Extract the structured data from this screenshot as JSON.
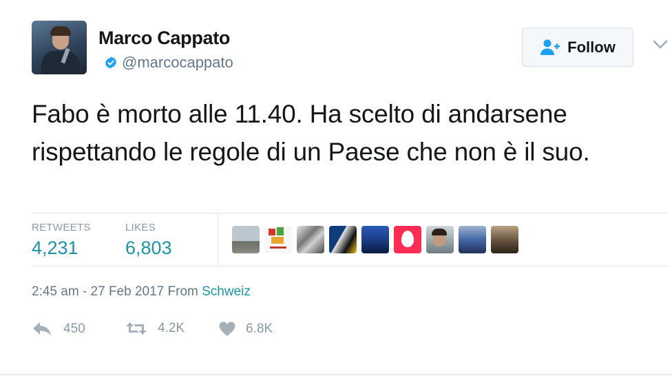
{
  "author": {
    "name": "Marco Cappato",
    "handle": "@marcocappato",
    "verified": true
  },
  "follow_button": {
    "label": "Follow",
    "icon": "follow-user-icon"
  },
  "tweet": {
    "text": "Fabo è morto alle 11.40. Ha scelto di andarsene rispettando le regole di un Paese che non è il suo."
  },
  "stats": {
    "retweets": {
      "label": "RETWEETS",
      "value": "4,231"
    },
    "likes": {
      "label": "LIKES",
      "value": "6,803"
    }
  },
  "likers_count_shown": 9,
  "meta": {
    "timestamp": "2:45 am - 27 Feb 2017 From ",
    "source": "Schweiz"
  },
  "actions": {
    "reply": {
      "count": "450",
      "icon": "reply-icon"
    },
    "retweet": {
      "count": "4.2K",
      "icon": "retweet-icon"
    },
    "like": {
      "count": "6.8K",
      "icon": "heart-icon"
    }
  },
  "colors": {
    "accent": "#1b95a5",
    "verified": "#1da1f2",
    "muted": "#657786",
    "divider": "#e1e8ed"
  }
}
